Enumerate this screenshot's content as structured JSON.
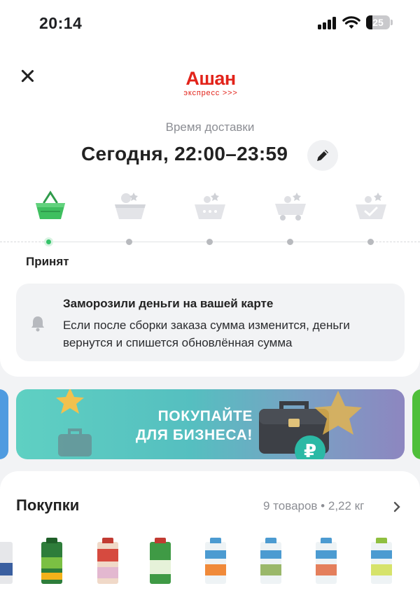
{
  "status_bar": {
    "time": "20:14",
    "battery": "25"
  },
  "brand": {
    "name": "Ашан",
    "subtitle": "экспресс >>>"
  },
  "delivery": {
    "label": "Время доставки",
    "time": "Сегодня, 22:00–23:59"
  },
  "order_status": {
    "current_step_label": "Принят",
    "steps": [
      "basket-icon",
      "basket-items-icon",
      "basket-pack-icon",
      "delivery-cart-icon",
      "basket-check-icon"
    ],
    "active_step_color": "#35c36a"
  },
  "notice": {
    "icon": "bell-icon",
    "title": "Заморозили деньги на вашей карте",
    "text": "Если после сборки заказа сумма изменится, деньги вернутся и спишется обновлённая сумма"
  },
  "banner": {
    "line1": "ПОКУПАЙТЕ",
    "line2": "ДЛЯ БИЗНЕСА!",
    "badge": "₽"
  },
  "purchases": {
    "title": "Покупки",
    "summary": "9 товаров • 2,22 кг"
  },
  "colors": {
    "brand_red": "#e2231a",
    "accent_green": "#35c36a",
    "muted_text": "#8c8e94"
  }
}
